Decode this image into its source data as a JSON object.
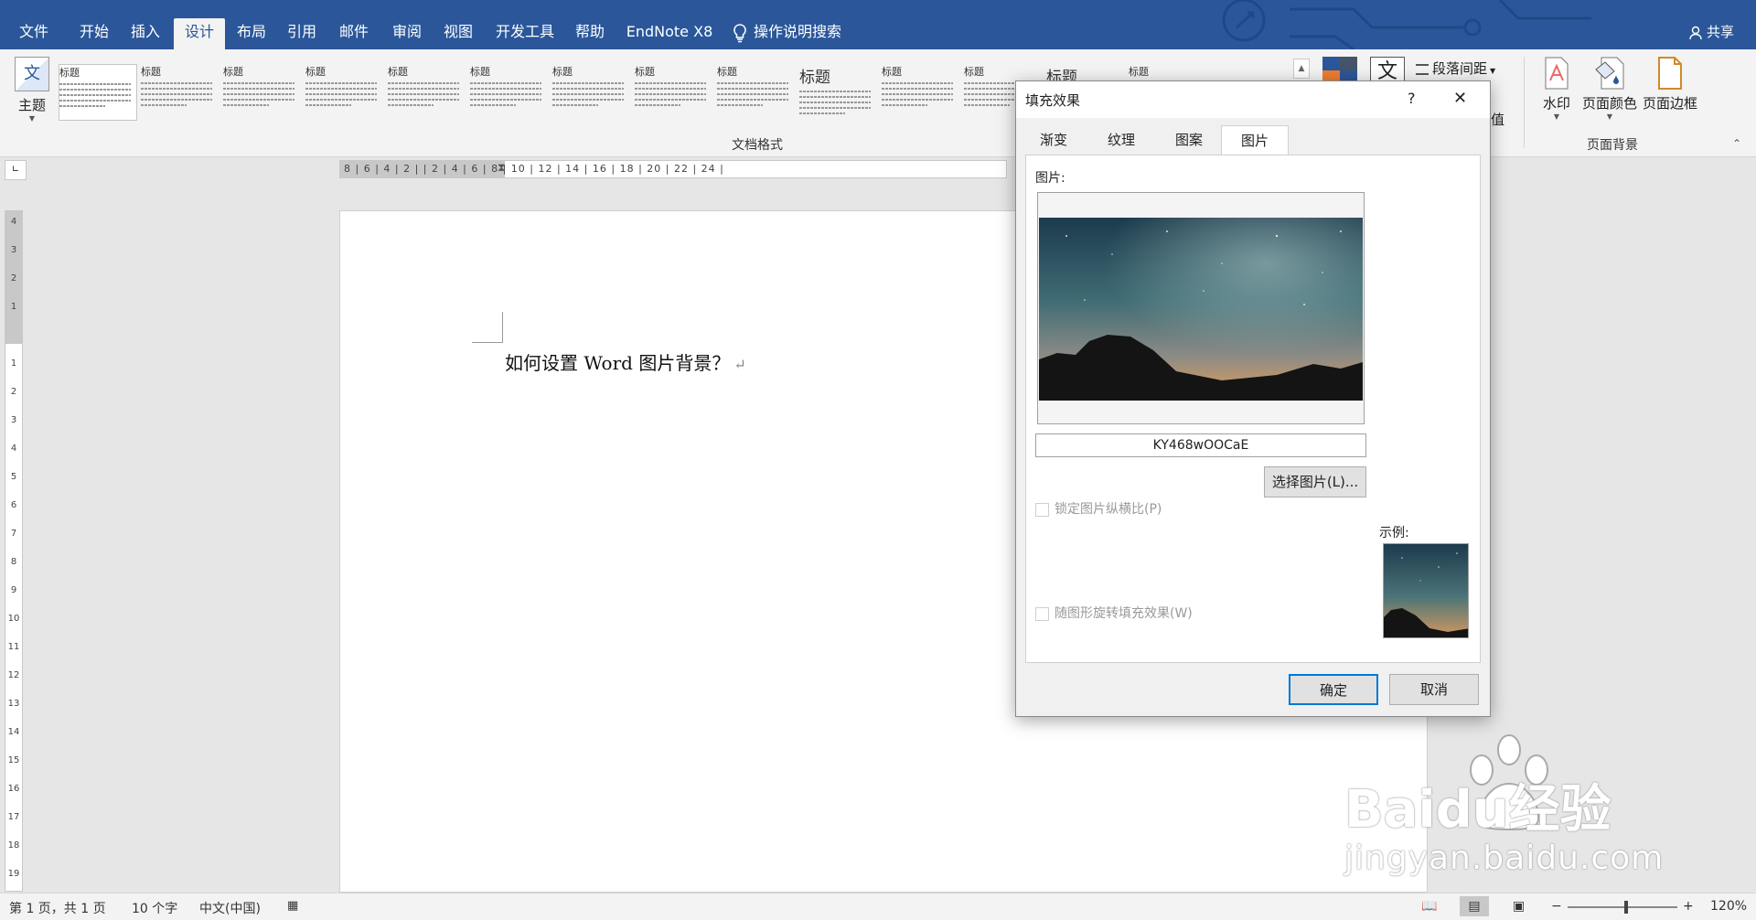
{
  "ribbon_tabs": [
    {
      "label": "文件"
    },
    {
      "label": "开始"
    },
    {
      "label": "插入"
    },
    {
      "label": "设计"
    },
    {
      "label": "布局"
    },
    {
      "label": "引用"
    },
    {
      "label": "邮件"
    },
    {
      "label": "审阅"
    },
    {
      "label": "视图"
    },
    {
      "label": "开发工具"
    },
    {
      "label": "帮助"
    },
    {
      "label": "EndNote X8"
    }
  ],
  "active_tab": "设计",
  "tell_me": "操作说明搜索",
  "share": "共享",
  "ribbon": {
    "theme_label": "主题",
    "style_titles": [
      "标题",
      "标题",
      "标题",
      "标题",
      "标题",
      "标题",
      "标题",
      "标题",
      "标题",
      "标题",
      "标题",
      "标题",
      "标题",
      "标题"
    ],
    "group_doc_format": "文档格式",
    "paragraph_spacing": "段落间距",
    "set_default_partial": "值",
    "watermark": "水印",
    "page_color": "页面颜色",
    "page_border": "页面边框",
    "group_page_background": "页面背景",
    "text_effect_glyph": "文"
  },
  "ruler": {
    "h_marks": "8 | 6 | 4 | 2 |  | 2 | 4 | 6 | 8 | 10 | 12 | 14 | 16 | 18 | 20 | 22 | 24 |",
    "v_marks": [
      "4",
      "3",
      "2",
      "1",
      "",
      "1",
      "2",
      "3",
      "4",
      "5",
      "6",
      "7",
      "8",
      "9",
      "10",
      "11",
      "12",
      "13",
      "14",
      "15",
      "16",
      "17",
      "18",
      "19"
    ]
  },
  "document": {
    "text": "如何设置 Word 图片背景？",
    "para_mark": "↵"
  },
  "status": {
    "page": "第 1 页，共 1 页",
    "words": "10 个字",
    "language": "中文(中国)",
    "zoom": "120%",
    "zoom_minus": "−",
    "zoom_plus": "+"
  },
  "dialog": {
    "title": "填充效果",
    "help": "?",
    "close": "✕",
    "tabs": [
      {
        "label": "渐变"
      },
      {
        "label": "纹理"
      },
      {
        "label": "图案"
      },
      {
        "label": "图片"
      }
    ],
    "active_tab": "图片",
    "picture_label": "图片:",
    "picture_name": "KY468wOOCaE",
    "select_button": "选择图片(L)...",
    "lock_aspect": "锁定图片纵横比(P)",
    "rotate_with_shape": "随图形旋转填充效果(W)",
    "sample_label": "示例:",
    "ok": "确定",
    "cancel": "取消"
  },
  "watermark": {
    "brand": "Baidu经验",
    "url": "jingyan.baidu.com"
  },
  "colors": {
    "ribbon_blue": "#2b579a",
    "accent_focus": "#0078d7"
  }
}
